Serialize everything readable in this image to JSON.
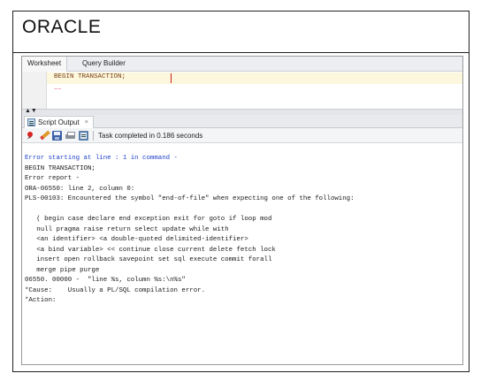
{
  "header": {
    "title": "ORACLE"
  },
  "worksheet": {
    "tabs": [
      "Worksheet",
      "Query Builder"
    ],
    "editor_line": "BEGIN TRANSACTION;",
    "error_marker": "~~"
  },
  "script_output": {
    "tab_label": "Script Output",
    "tab_close": "×",
    "status_text": "Task completed in 0.186 seconds",
    "lines": [
      "Error starting at line : 1 in command -",
      "BEGIN TRANSACTION;",
      "Error report -",
      "ORA-06550: line 2, column 0:",
      "PLS-00103: Encountered the symbol \"end-of-file\" when expecting one of the following:",
      "",
      "   ( begin case declare end exception exit for goto if loop mod",
      "   null pragma raise return select update while with",
      "   <an identifier> <a double-quoted delimited-identifier>",
      "   <a bind variable> << continue close current delete fetch lock",
      "   insert open rollback savepoint set sql execute commit forall",
      "   merge pipe purge",
      "06550. 00000 -  \"line %s, column %s:\\n%s\"",
      "*Cause:    Usually a PL/SQL compilation error.",
      "*Action:"
    ]
  },
  "colors": {
    "error_heading": "#1f3fc9",
    "keyword": "#7a3e14"
  }
}
